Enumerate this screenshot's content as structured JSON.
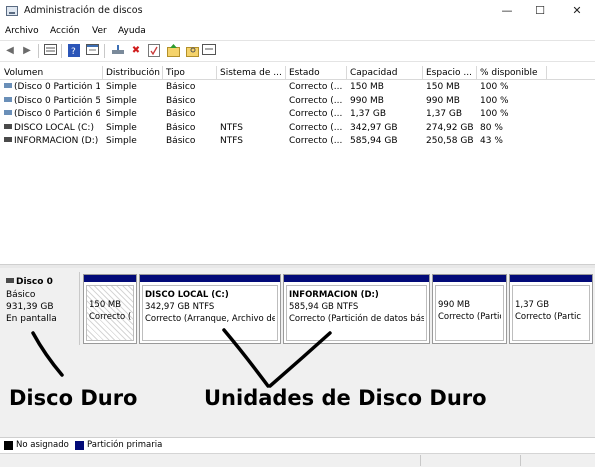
{
  "window": {
    "title": "Administración de discos",
    "minimize": "—",
    "maximize": "☐",
    "close": "✕"
  },
  "menu": [
    "Archivo",
    "Acción",
    "Ver",
    "Ayuda"
  ],
  "toolbar_icons": [
    "back-arrow-icon",
    "forward-arrow-icon",
    "list-view-icon",
    "help-icon",
    "properties-icon",
    "connect-icon",
    "delete-icon",
    "check-icon",
    "folder-up-icon",
    "folder-search-icon",
    "rename-icon"
  ],
  "table": {
    "columns": [
      "Volumen",
      "Distribución",
      "Tipo",
      "Sistema de ...",
      "Estado",
      "Capacidad",
      "Espacio ...",
      "% disponible"
    ],
    "rows": [
      [
        "(Disco 0 Partición 1)",
        "Simple",
        "Básico",
        "",
        "Correcto (...",
        "150 MB",
        "150 MB",
        "100 %"
      ],
      [
        "(Disco 0 Partición 5)",
        "Simple",
        "Básico",
        "",
        "Correcto (...",
        "990 MB",
        "990 MB",
        "100 %"
      ],
      [
        "(Disco 0 Partición 6)",
        "Simple",
        "Básico",
        "",
        "Correcto (...",
        "1,37 GB",
        "1,37 GB",
        "100 %"
      ],
      [
        "DISCO LOCAL  (C:)",
        "Simple",
        "Básico",
        "NTFS",
        "Correcto (...",
        "342,97 GB",
        "274,92 GB",
        "80 %"
      ],
      [
        "INFORMACION (D:)",
        "Simple",
        "Básico",
        "NTFS",
        "Correcto (...",
        "585,94 GB",
        "250,58 GB",
        "43 %"
      ]
    ]
  },
  "disk": {
    "name": "Disco 0",
    "type": "Básico",
    "size": "931,39 GB",
    "status": "En pantalla"
  },
  "partitions": [
    {
      "name": "",
      "size": "150 MB",
      "status": "Correcto (P"
    },
    {
      "name": "DISCO LOCAL  (C:)",
      "size": "342,97 GB NTFS",
      "status": "Correcto (Arranque, Archivo de"
    },
    {
      "name": "INFORMACION  (D:)",
      "size": "585,94 GB NTFS",
      "status": "Correcto (Partición de datos bási"
    },
    {
      "name": "",
      "size": "990 MB",
      "status": "Correcto (Partic"
    },
    {
      "name": "",
      "size": "1,37 GB",
      "status": "Correcto (Partic"
    }
  ],
  "annotations": {
    "left": "Disco Duro",
    "right": "Unidades de Disco Duro"
  },
  "legend": [
    {
      "label": "No asignado",
      "color": "#000000"
    },
    {
      "label": "Partición primaria",
      "color": "#020a78"
    }
  ]
}
